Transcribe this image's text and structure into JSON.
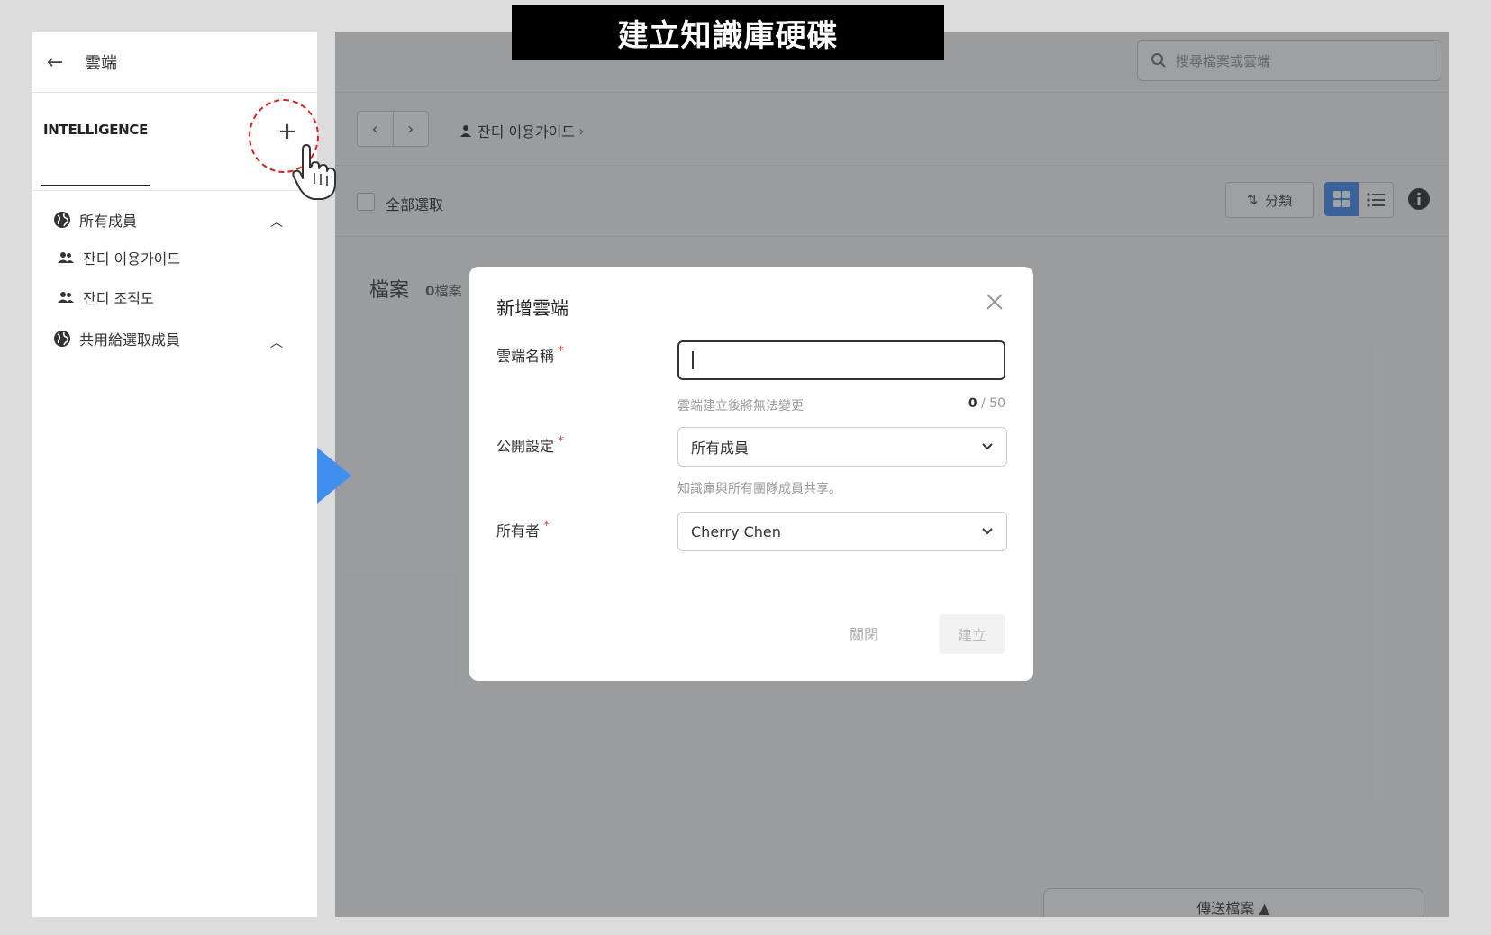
{
  "banner": {
    "title": "建立知識庫硬碟"
  },
  "sidebar": {
    "back_icon": "arrow-left-icon",
    "title": "雲端",
    "tab_label": "INTELLIGENCE",
    "add_label": "+",
    "items": [
      {
        "label": "所有成員",
        "icon": "globe-icon",
        "expanded": true
      },
      {
        "label": "잔디 이용가이드",
        "icon": "people-icon"
      },
      {
        "label": "잔디 조직도",
        "icon": "people-icon"
      },
      {
        "label": "共用給選取成員",
        "icon": "globe-icon",
        "expanded": true
      }
    ]
  },
  "main": {
    "search_placeholder": "搜尋檔案或雲端",
    "nav_prev": "‹",
    "nav_next": "›",
    "breadcrumb": "잔디 이용가이드",
    "breadcrumb_sep": "›",
    "select_all": "全部選取",
    "sort_label": "分類",
    "files_heading": "檔案",
    "files_count": "0",
    "files_unit": "檔案",
    "send_files": "傳送檔案 ▲"
  },
  "modal": {
    "title": "新增雲端",
    "name_label": "雲端名稱",
    "name_help": "雲端建立後將無法變更",
    "name_count": "0",
    "name_max": "/ 50",
    "visibility_label": "公開設定",
    "visibility_value": "所有成員",
    "visibility_help": "知識庫與所有團隊成員共享。",
    "owner_label": "所有者",
    "owner_value": "Cherry Chen",
    "cancel_label": "關閉",
    "create_label": "建立",
    "required_mark": "*"
  },
  "colors": {
    "accent": "#3f8ff0",
    "required": "#e04646",
    "highlight": "#e02020",
    "banner_bg": "#000000"
  }
}
